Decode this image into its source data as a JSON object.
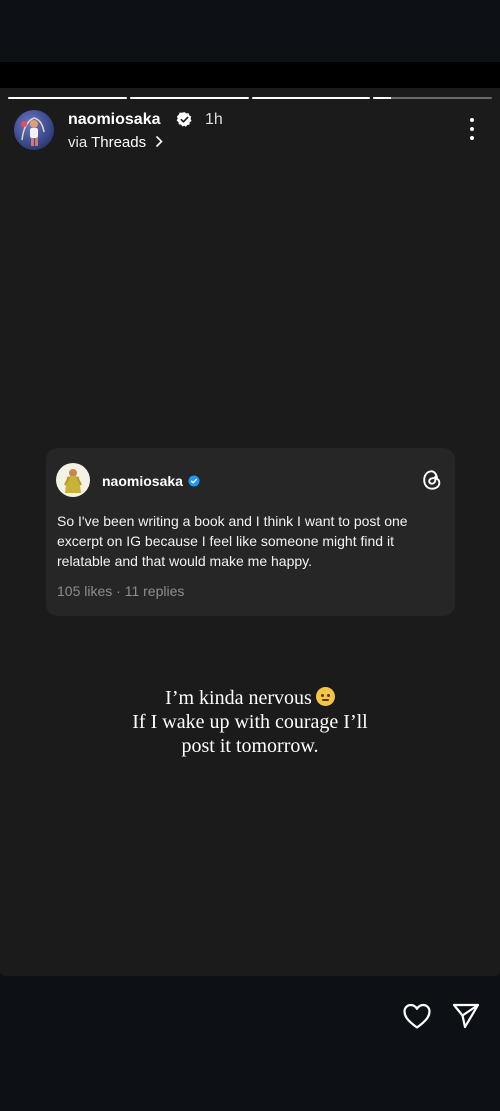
{
  "story": {
    "progress": [
      1.0,
      1.0,
      1.0,
      0.15
    ],
    "username": "naomiosaka",
    "time_ago": "1h",
    "via_label": "via",
    "via_app": "Threads"
  },
  "threads_card": {
    "username": "naomiosaka",
    "text": "So I've been writing a book and I think I want to post one excerpt on IG because I feel like someone might find it relatable and that would make me happy.",
    "likes": "105 likes",
    "separator": "·",
    "replies": "11 replies"
  },
  "caption": {
    "line1": "I’m kinda nervous",
    "line2": "If I wake up with courage I’ll",
    "line3": "post it tomorrow."
  },
  "icons": {
    "verified": "verified-badge-icon",
    "more": "more-options-icon",
    "threads": "threads-logo-icon",
    "like": "heart-icon",
    "share": "send-icon",
    "emoji": "nervous-emoji-icon"
  },
  "colors": {
    "verified_blue": "#1d9bf0",
    "story_bg": "#1b1b1b",
    "card_bg": "#262626"
  }
}
